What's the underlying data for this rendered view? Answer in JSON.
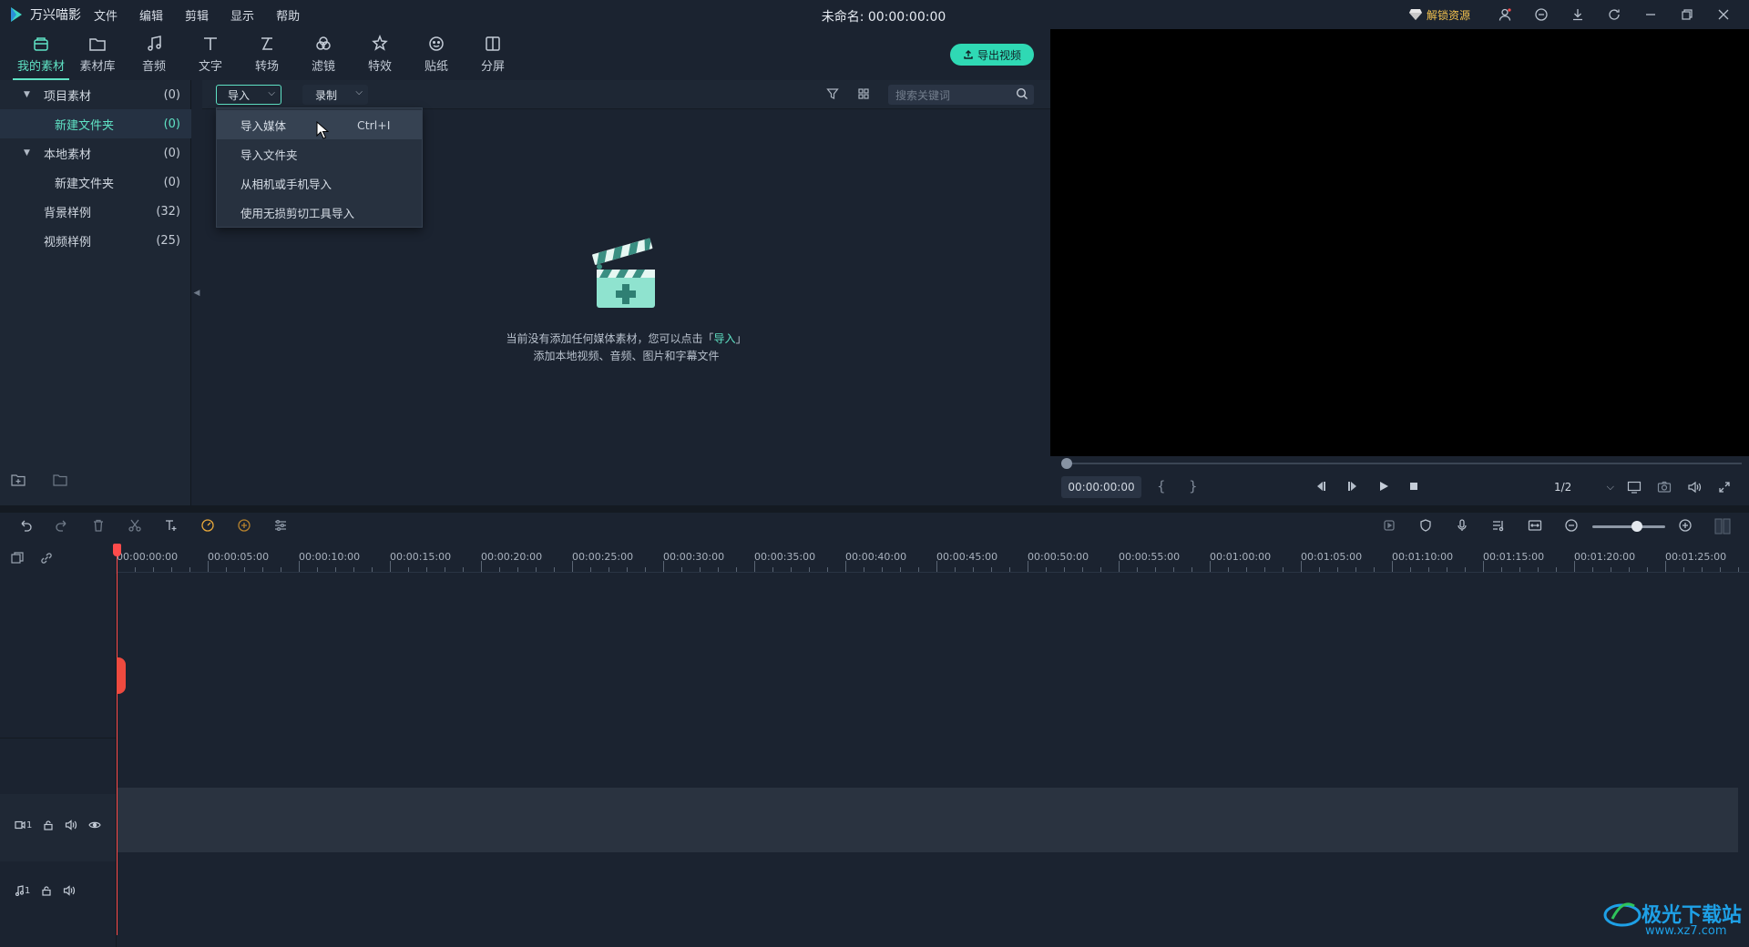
{
  "app": {
    "name": "万兴喵影",
    "menu": [
      "文件",
      "编辑",
      "剪辑",
      "显示",
      "帮助"
    ],
    "document_title": "未命名: 00:00:00:00",
    "unlock_label": "解锁资源"
  },
  "toolbar": {
    "tools": [
      {
        "label": "我的素材",
        "icon": "my-media-icon",
        "active": true
      },
      {
        "label": "素材库",
        "icon": "folder-icon"
      },
      {
        "label": "音频",
        "icon": "music-note-icon"
      },
      {
        "label": "文字",
        "icon": "text-icon"
      },
      {
        "label": "转场",
        "icon": "transition-icon"
      },
      {
        "label": "滤镜",
        "icon": "filter-icon"
      },
      {
        "label": "特效",
        "icon": "effects-icon"
      },
      {
        "label": "贴纸",
        "icon": "sticker-icon"
      },
      {
        "label": "分屏",
        "icon": "split-screen-icon"
      }
    ],
    "export_label": "导出视频"
  },
  "media_tree": [
    {
      "name": "项目素材",
      "count": "(0)",
      "expanded": true
    },
    {
      "name": "新建文件夹",
      "count": "(0)",
      "selected": true
    },
    {
      "name": "本地素材",
      "count": "(0)",
      "expanded": true
    },
    {
      "name": "新建文件夹",
      "count": "(0)"
    },
    {
      "name": "背景样例",
      "count": "(32)"
    },
    {
      "name": "视频样例",
      "count": "(25)"
    }
  ],
  "media_bar": {
    "import_label": "导入",
    "record_label": "录制",
    "search_placeholder": "搜索关键词"
  },
  "import_menu": [
    {
      "label": "导入媒体",
      "shortcut": "Ctrl+I"
    },
    {
      "label": "导入文件夹",
      "shortcut": ""
    },
    {
      "label": "从相机或手机导入",
      "shortcut": ""
    },
    {
      "label": "使用无损剪切工具导入",
      "shortcut": ""
    }
  ],
  "empty_state": {
    "line1_prefix": "当前没有添加任何媒体素材，您可以点击「",
    "line1_link": "导入",
    "line1_suffix": "」",
    "line2": "添加本地视频、音频、图片和字幕文件"
  },
  "preview": {
    "timecode": "00:00:00:00",
    "mark_in": "{",
    "mark_out": "}",
    "ratio": "1/2"
  },
  "ruler": {
    "labels": [
      "00:00:00:00",
      "00:00:05:00",
      "00:00:10:00",
      "00:00:15:00",
      "00:00:20:00",
      "00:00:25:00",
      "00:00:30:00",
      "00:00:35:00",
      "00:00:40:00",
      "00:00:45:00",
      "00:00:50:00",
      "00:00:55:00",
      "00:01:00:00",
      "00:01:05:00",
      "00:01:10:00",
      "00:01:15:00",
      "00:01:20:00",
      "00:01:25:00"
    ]
  },
  "tracks": {
    "video_track_label": "1",
    "audio_track_label": "1"
  },
  "watermark": {
    "text": "极光下载站",
    "url": "www.xz7.com"
  },
  "colors": {
    "accent": "#5fe3c5",
    "playhead": "#ff4b4b",
    "unlock": "#f2c14e"
  }
}
